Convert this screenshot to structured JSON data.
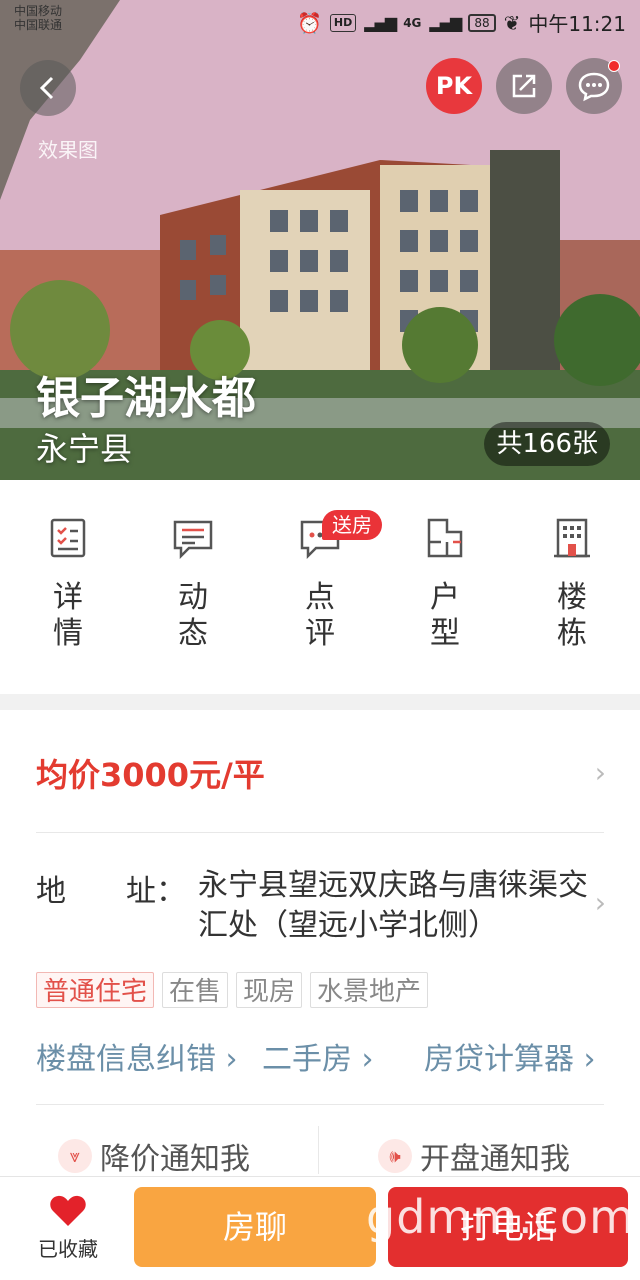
{
  "status_bar": {
    "carrier_1": "中国移动",
    "carrier_2": "中国联通",
    "hd": "HD",
    "network": "4G",
    "battery": "88",
    "time": "中午11:21"
  },
  "header": {
    "pk_label": "PK",
    "render_label": "效果图"
  },
  "project": {
    "name": "银子湖水都",
    "district": "永宁县",
    "photo_count": "共166张"
  },
  "nav": {
    "items": [
      {
        "label": "详\n情",
        "icon": "detail-icon"
      },
      {
        "label": "动\n态",
        "icon": "news-icon"
      },
      {
        "label": "点\n评",
        "icon": "comment-icon"
      },
      {
        "label": "户\n型",
        "icon": "floorplan-icon"
      },
      {
        "label": "楼\n栋",
        "icon": "building-icon"
      }
    ],
    "badge": "送房"
  },
  "info": {
    "price": "均价3000元/平",
    "address_label": "地　　址：",
    "address": "永宁县望远双庆路与唐徕渠交汇处（望远小学北侧）",
    "tags": [
      "普通住宅",
      "在售",
      "现房",
      "水景地产"
    ],
    "links": [
      "楼盘信息纠错",
      "二手房",
      "房贷计算器"
    ],
    "notify_price": "降价通知我",
    "notify_open": "开盘通知我"
  },
  "bottom": {
    "fav_label": "已收藏",
    "chat_label": "房聊",
    "call_label": "打电话",
    "watermark": "gdmm.com"
  },
  "colors": {
    "accent_red": "#e32f2f",
    "accent_orange": "#f9a541",
    "price_red": "#e33b30",
    "link_blue": "#6b8fa8"
  }
}
